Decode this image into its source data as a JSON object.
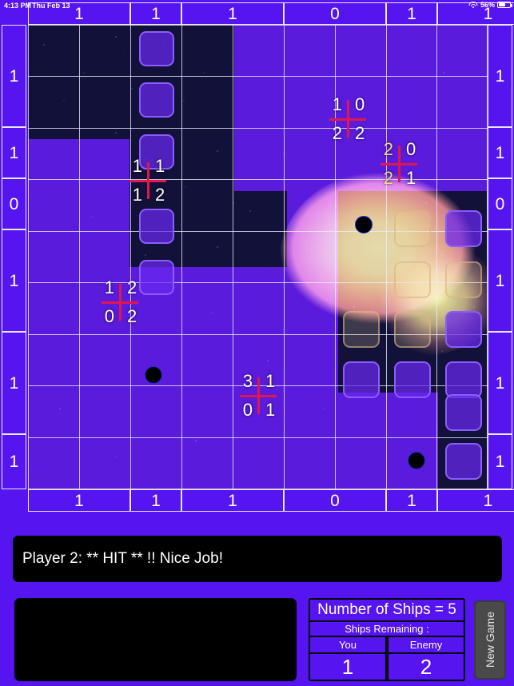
{
  "status_bar": {
    "time": "4:13 PM",
    "date": "Thu Feb 13",
    "battery_percent": "56%",
    "wifi_icon": "wifi-icon",
    "battery_icon": "battery-icon"
  },
  "board": {
    "columns": 9,
    "rows": 9,
    "top_labels": [
      "1",
      "1",
      "1",
      "0",
      "1",
      "1"
    ],
    "bottom_labels": [
      "1",
      "1",
      "1",
      "0",
      "1",
      "1"
    ],
    "left_labels": [
      "1",
      "1",
      "0",
      "1",
      "1",
      "1"
    ],
    "right_labels": [
      "1",
      "1",
      "0",
      "1",
      "1",
      "1"
    ],
    "crosshairs": [
      {
        "name": "crosshair-1",
        "tl": "1",
        "tr": "0",
        "bl": "2",
        "br": "2"
      },
      {
        "name": "crosshair-2",
        "tl": "2",
        "tr": "0",
        "bl": "2",
        "br": "1"
      },
      {
        "name": "crosshair-3",
        "tl": "1",
        "tr": "1",
        "bl": "1",
        "br": "2"
      },
      {
        "name": "crosshair-4",
        "tl": "1",
        "tr": "2",
        "bl": "0",
        "br": "2"
      },
      {
        "name": "crosshair-5",
        "tl": "3",
        "tr": "1",
        "bl": "0",
        "br": "1"
      }
    ],
    "hit_markers": 3
  },
  "message": {
    "text": "Player 2: ** HIT ** !!   Nice Job!"
  },
  "ships_panel": {
    "title": "Number of Ships = 5",
    "subtitle": "Ships Remaining :",
    "you_label": "You",
    "enemy_label": "Enemy",
    "you_value": "1",
    "enemy_value": "2"
  },
  "new_game_button": {
    "label": "New Game"
  },
  "colors": {
    "purple": "#5614f0",
    "grid_line": "#ececff",
    "crosshair_red": "#e0174b",
    "panel_black": "#000000"
  }
}
